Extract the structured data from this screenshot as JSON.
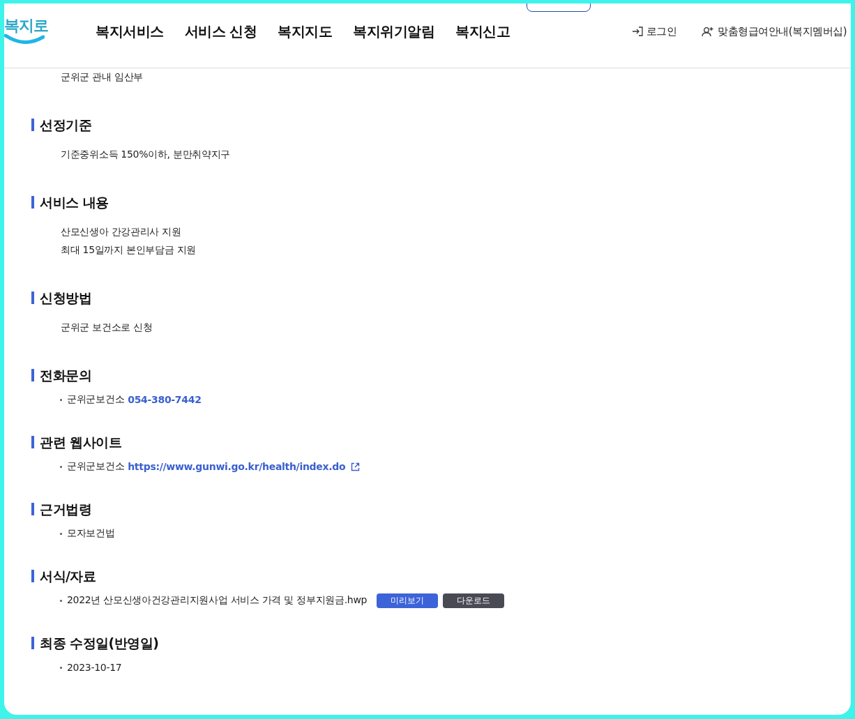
{
  "header": {
    "logo": "복지로",
    "nav": [
      "복지서비스",
      "서비스 신청",
      "복지지도",
      "복지위기알림",
      "복지신고"
    ],
    "login": "로그인",
    "membership": "맞춤형급여안내(복지멤버십)"
  },
  "sections": [
    {
      "kind": "text",
      "lines": [
        "군위군 관내 임산부"
      ]
    },
    {
      "kind": "text",
      "heading": "선정기준",
      "lines": [
        "기준중위소득 150%이하, 분만취약지구"
      ]
    },
    {
      "kind": "text",
      "heading": "서비스 내용",
      "lines": [
        "산모신생아 간강관리사 지원",
        "최대 15일까지 본인부담금 지원"
      ]
    },
    {
      "kind": "text",
      "heading": "신청방법",
      "lines": [
        "군위군 보건소로 신청"
      ]
    },
    {
      "kind": "bullets",
      "heading": "전화문의",
      "items": [
        {
          "text": "군위군보건소",
          "link": "054-380-7442"
        }
      ]
    },
    {
      "kind": "bullets",
      "heading": "관련 웹사이트",
      "items": [
        {
          "text": "군위군보건소",
          "link": "https://www.gunwi.go.kr/health/index.do",
          "external": true
        }
      ]
    },
    {
      "kind": "bullets",
      "heading": "근거법령",
      "items": [
        {
          "text": "모자보건법"
        }
      ]
    },
    {
      "kind": "bullets",
      "heading": "서식/자료",
      "items": [
        {
          "text": "2022년 산모신생아건강관리지원사업 서비스 가격 및 정부지원금.hwp",
          "buttons": [
            {
              "label": "미리보기",
              "kind": "preview"
            },
            {
              "label": "다운로드",
              "kind": "download"
            }
          ]
        }
      ]
    },
    {
      "kind": "bullets",
      "heading": "최종 수정일(반영일)",
      "items": [
        {
          "text": "2023-10-17"
        }
      ]
    }
  ]
}
